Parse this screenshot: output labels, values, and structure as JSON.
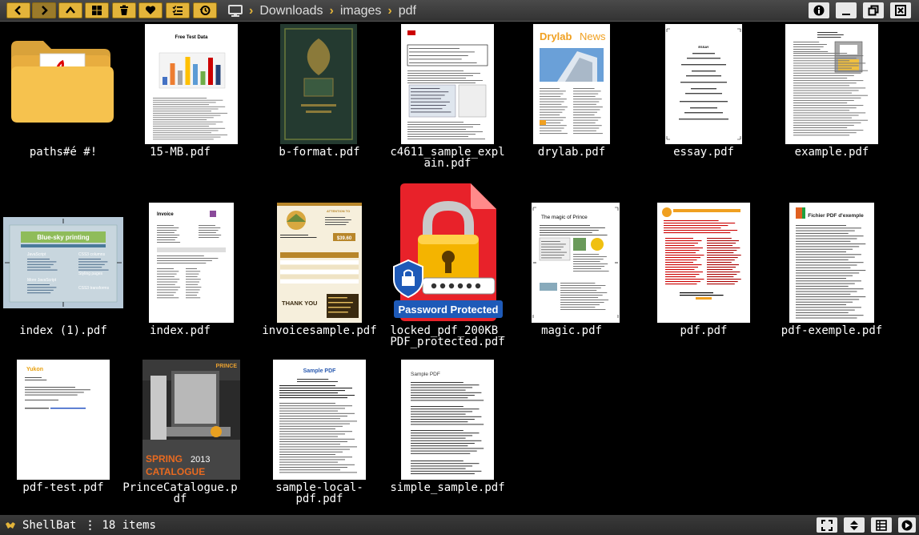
{
  "toolbar": {
    "buttons": [
      "back-icon",
      "forward-icon",
      "up-icon",
      "windows-icon",
      "trash-icon",
      "heart-icon",
      "checklist-icon",
      "history-icon"
    ],
    "accent": "#e3b43a"
  },
  "breadcrumb": {
    "root_icon": "monitor-icon",
    "parts": [
      "Downloads",
      "images",
      "pdf"
    ]
  },
  "window_controls": [
    "info-icon",
    "minimize-icon",
    "restore-icon",
    "close-icon"
  ],
  "files": [
    {
      "name": "paths#é #!",
      "kind": "folder"
    },
    {
      "name": "15-MB.pdf",
      "kind": "pdf",
      "thumb": "chart"
    },
    {
      "name": "b-format.pdf",
      "kind": "pdf",
      "thumb": "book"
    },
    {
      "name": "c4611_sample_expl\nain.pdf",
      "kind": "pdf",
      "thumb": "form"
    },
    {
      "name": "drylab.pdf",
      "kind": "pdf",
      "thumb": "news"
    },
    {
      "name": "essay.pdf",
      "kind": "pdf",
      "thumb": "essay"
    },
    {
      "name": "example.pdf",
      "kind": "pdf",
      "thumb": "example"
    },
    {
      "name": "index (1).pdf",
      "kind": "pdf",
      "thumb": "sky"
    },
    {
      "name": "index.pdf",
      "kind": "pdf",
      "thumb": "invoice"
    },
    {
      "name": "invoicesample.pdf",
      "kind": "pdf",
      "thumb": "invoicesample"
    },
    {
      "name": "locked_pdf_200KB_\nPDF_protected.pdf",
      "kind": "locked"
    },
    {
      "name": "magic.pdf",
      "kind": "pdf",
      "thumb": "magic"
    },
    {
      "name": "pdf.pdf",
      "kind": "pdf",
      "thumb": "redtext"
    },
    {
      "name": "pdf-exemple.pdf",
      "kind": "pdf",
      "thumb": "exemple"
    },
    {
      "name": "pdf-test.pdf",
      "kind": "pdf",
      "thumb": "yukon"
    },
    {
      "name": "PrinceCatalogue.p\ndf",
      "kind": "pdf",
      "thumb": "prince"
    },
    {
      "name": "sample-local-\npdf.pdf",
      "kind": "pdf",
      "thumb": "samplepdf"
    },
    {
      "name": "simple_sample.pdf",
      "kind": "pdf",
      "thumb": "simple"
    }
  ],
  "thumb_text": {
    "chart_title": "Free Test Data",
    "drylab_title": "Drylab",
    "drylab_title2": "News",
    "lock_banner": "Password Protected",
    "magic_title": "The magic of Prince",
    "exemple_title": "Fichier PDF d'exemple",
    "yukon": "Yukon",
    "prince_brand": "PRINCE",
    "prince_spring": "SPRING",
    "prince_year": "2013",
    "prince_catalogue": "CATALOGUE",
    "sample_title": "Sample PDF",
    "simple_title": "Sample PDF",
    "invoice_title": "Invoice",
    "thank_you": "THANK YOU",
    "price": "$39.60",
    "sky_title": "Blue-sky printing",
    "essay_title": "ESSAY"
  },
  "status": {
    "app_name": "ShellBat",
    "menu": "⋮",
    "count": "18 items",
    "buttons": [
      "fullscreen-icon",
      "sort-icon",
      "view-icon",
      "play-icon"
    ]
  }
}
